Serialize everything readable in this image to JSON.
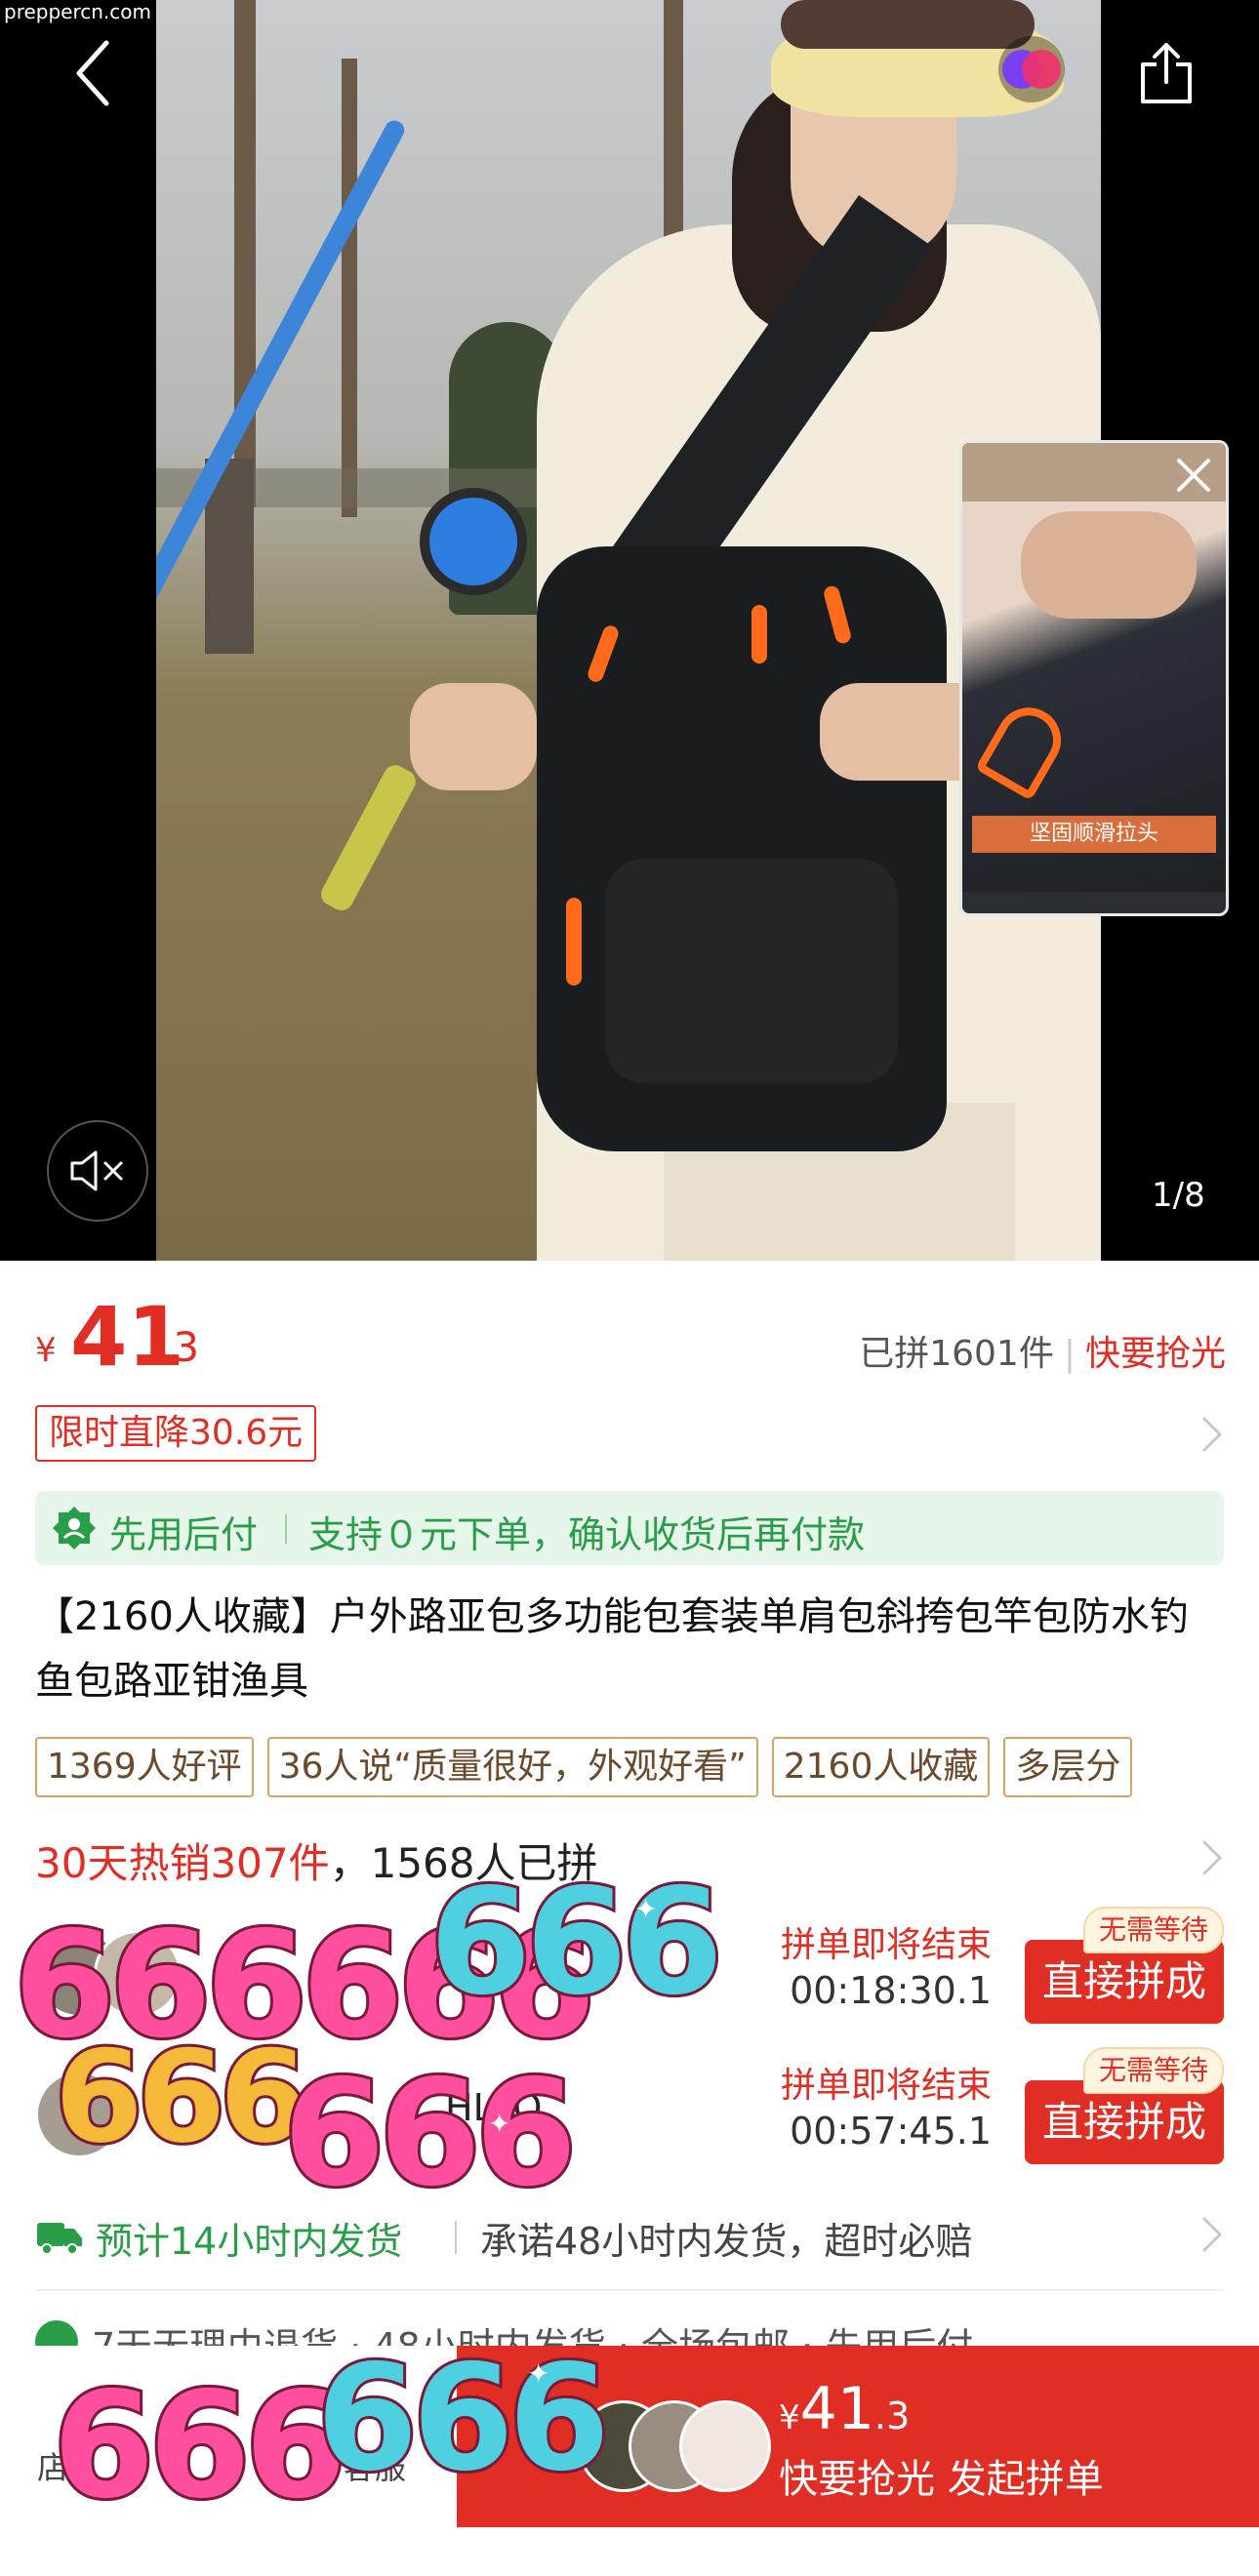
{
  "watermark": "preppercn.com",
  "media": {
    "counter": "1/8",
    "mini_caption": "坚固顺滑拉头",
    "icons": [
      "back-arrow-icon",
      "share-icon",
      "mute-icon",
      "close-icon"
    ]
  },
  "price": {
    "currency": "¥",
    "integer": "41",
    "decimal": ".3",
    "sold": "已拼1601件",
    "urgency": "快要抢光"
  },
  "discount_tag": "限时直降30.6元",
  "paylater": {
    "title": "先用后付",
    "desc": "支持０元下单，确认收货后再付款"
  },
  "title": "【2160人收藏】户外路亚包多功能包套装单肩包斜挎包竿包防水钓鱼包路亚钳渔具",
  "tags": [
    "1369人好评",
    "36人说“质量很好，外观好看”",
    "2160人收藏",
    "多层分"
  ],
  "hot": {
    "sales": "30天热销307件",
    "joined": "，1568人已拼"
  },
  "groups": [
    {
      "user": "",
      "ending": "拼单即将结束",
      "countdown": "00:18:30.1",
      "button": "直接拼成",
      "badge": "无需等待"
    },
    {
      "user": "HLLO",
      "ending": "拼单即将结束",
      "countdown": "00:57:45.1",
      "button": "直接拼成",
      "badge": "无需等待"
    }
  ],
  "shipping": {
    "eta": "预计14小时内发货",
    "promise": "承诺48小时内发货，超时必赔"
  },
  "services": "7天无理由退货 · 48小时内发货 · 全场包邮 · 先用后付",
  "bottom": {
    "nav_store": "店",
    "nav_service": "客服",
    "buy_currency": "¥",
    "buy_integer": "41",
    "buy_decimal": ".3",
    "buy_label": "快要抢光 发起拼单"
  },
  "stickers": {
    "a": "666666",
    "b": "666",
    "c": "666",
    "d": "666",
    "e": "666",
    "f": "666"
  },
  "colors": {
    "accent_red": "#e02e24",
    "paylater_green": "#2a9d48",
    "paylater_bg": "#e7f6ea"
  }
}
